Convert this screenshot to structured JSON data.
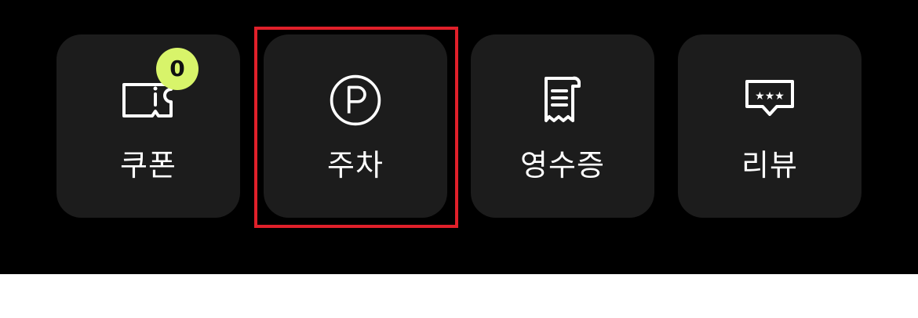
{
  "quick_actions": [
    {
      "id": "coupon",
      "label": "쿠폰",
      "icon": "coupon-icon",
      "badge": "0"
    },
    {
      "id": "parking",
      "label": "주차",
      "icon": "parking-icon"
    },
    {
      "id": "receipt",
      "label": "영수증",
      "icon": "receipt-icon"
    },
    {
      "id": "review",
      "label": "리뷰",
      "icon": "review-icon"
    }
  ],
  "colors": {
    "panel_background": "#000000",
    "tile_background": "#1c1c1c",
    "badge_background": "#d8f46a",
    "highlight_border": "#e0202a",
    "text": "#ffffff"
  }
}
